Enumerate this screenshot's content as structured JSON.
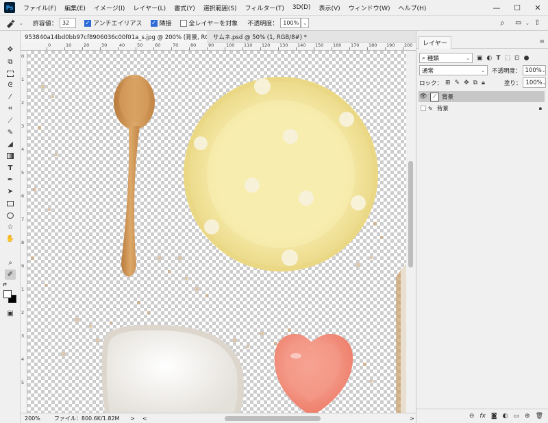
{
  "app": {
    "logo": "Ps"
  },
  "menu": [
    "ファイル(F)",
    "編集(E)",
    "イメージ(I)",
    "レイヤー(L)",
    "書式(Y)",
    "選択範囲(S)",
    "フィルター(T)",
    "3D(D)",
    "表示(V)",
    "ウィンドウ(W)",
    "ヘルプ(H)"
  ],
  "window_controls": {
    "minimize": "—",
    "maximize": "☐",
    "close": "✕"
  },
  "options": {
    "tolerance_label": "許容値：",
    "tolerance_value": "32",
    "antialias_label": "アンチエイリアス",
    "antialias_checked": true,
    "contiguous_label": "隣接",
    "contiguous_checked": true,
    "all_layers_label": "全レイヤーを対象",
    "all_layers_checked": false,
    "opacity_label": "不透明度：",
    "opacity_value": "100%"
  },
  "tools": [
    "move-icon",
    "artboard-icon",
    "marquee-icon",
    "lasso-icon",
    "magic-wand-icon",
    "crop-icon",
    "eyedropper-icon",
    "brush-icon",
    "eraser-icon",
    "gradient-icon",
    "type-icon",
    "pen-icon",
    "path-select-icon",
    "rectangle-icon",
    "ellipse-icon",
    "custom-shape-icon",
    "hand-icon",
    "zoom-icon",
    "magic-eraser-icon"
  ],
  "tabs": [
    {
      "label": "953840a14bd0bb97cf8906036c00f01a_s.jpg @ 200% (背景, RGB/8#) *",
      "close": "×",
      "active": true
    },
    {
      "label": "サムネ.psd @ 50% (1, RGB/8#) *",
      "close": "×",
      "active": false
    }
  ],
  "rulers": {
    "top_labels": [
      "0",
      "10",
      "20",
      "30",
      "40",
      "50",
      "60",
      "70",
      "80",
      "90",
      "100",
      "110",
      "120",
      "130",
      "140",
      "150",
      "160",
      "170",
      "180",
      "190",
      "200",
      "210"
    ],
    "left_labels": [
      "0",
      "1",
      "2",
      "3",
      "4",
      "5",
      "6",
      "7",
      "8",
      "9",
      "1",
      "2",
      "3",
      "4",
      "5"
    ]
  },
  "status": {
    "zoom": "200%",
    "file_info": "ファイル：800.6K/1.82M",
    "nav_arrow": ">",
    "scroll_left": "<",
    "scroll_right": ">"
  },
  "layers_panel": {
    "tab_label": "レイヤー",
    "menu_icon": "≡",
    "filter_kind": "種類",
    "blend_mode": "通常",
    "opacity_label": "不透明度：",
    "opacity_value": "100%",
    "lock_label": "ロック：",
    "fill_label": "塗り：",
    "fill_value": "100%",
    "layers": [
      {
        "name": "背景",
        "visible": true,
        "selected": true,
        "locked": false
      },
      {
        "name": "背景",
        "visible": false,
        "selected": false,
        "locked": true
      }
    ],
    "footer_icons": [
      "link-icon",
      "fx-icon",
      "mask-icon",
      "adjustment-icon",
      "group-icon",
      "new-layer-icon",
      "trash-icon"
    ]
  },
  "colors": {
    "plate": "#f3e6a2",
    "plate_rim": "#ead88a",
    "spoon": "#cf9a5e",
    "heart_dish": "#f28d7b",
    "white_bowl": "#f1efec",
    "accent_blue": "#2c6bd6"
  }
}
